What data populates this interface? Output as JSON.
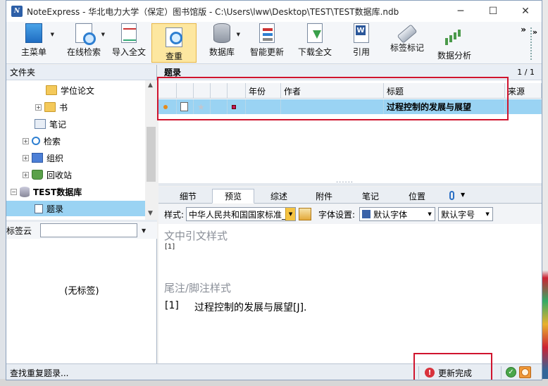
{
  "window": {
    "title": "NoteExpress - 华北电力大学（保定）图书馆版 - C:\\Users\\lww\\Desktop\\TEST\\TEST数据库.ndb",
    "logo_text": "N",
    "minimize": "─",
    "maximize": "☐",
    "close": "✕"
  },
  "toolbar": {
    "items": [
      {
        "label": "主菜单",
        "icon": "main-menu-icon"
      },
      {
        "label": "在线检索",
        "icon": "online-search-icon"
      },
      {
        "label": "导入全文",
        "icon": "import-fulltext-icon"
      },
      {
        "label": "查重",
        "icon": "dedupe-icon"
      },
      {
        "label": "数据库",
        "icon": "database-icon"
      },
      {
        "label": "智能更新",
        "icon": "smart-update-icon"
      },
      {
        "label": "下载全文",
        "icon": "download-fulltext-icon"
      },
      {
        "label": "引用",
        "icon": "cite-icon"
      },
      {
        "label": "标签标记",
        "icon": "tag-mark-icon"
      },
      {
        "label": "数据分析",
        "icon": "data-analysis-icon"
      }
    ],
    "more": "»"
  },
  "folders": {
    "header": "文件夹",
    "tree": [
      {
        "label": "学位论文"
      },
      {
        "label": "书"
      },
      {
        "label": "笔记"
      },
      {
        "label": "检索"
      },
      {
        "label": "组织"
      },
      {
        "label": "回收站"
      },
      {
        "label": "TEST数据库"
      },
      {
        "label": "题录"
      }
    ],
    "expand": "+",
    "collapse": "−"
  },
  "tagcloud": {
    "label": "标签云",
    "empty_text": "(无标签)"
  },
  "records": {
    "header": "题录",
    "count": "1 / 1",
    "columns": [
      "年份",
      "作者",
      "标题",
      "来源"
    ],
    "rows": [
      {
        "year": "",
        "author": "",
        "title": "过程控制的发展与展望",
        "source": ""
      }
    ]
  },
  "tabs": [
    "细节",
    "预览",
    "综述",
    "附件",
    "笔记",
    "位置"
  ],
  "style_bar": {
    "style_label": "样式:",
    "style_value": "中华人民共和国国家标准_",
    "font_label": "字体设置:",
    "font_value": "默认字体",
    "size_value": "默认字号"
  },
  "preview": {
    "intext_heading": "文中引文样式",
    "intext_cite": "[1]",
    "footnote_heading": "尾注/脚注样式",
    "ref_num": "[1]",
    "ref_text": "过程控制的发展与展望[J]."
  },
  "status": {
    "left_text": "查找重复题录...",
    "done_text": "更新完成"
  },
  "colors": {
    "selection": "#9ad3f3",
    "highlight_box": "#d0142e",
    "active_tool": "#fde7a0"
  }
}
